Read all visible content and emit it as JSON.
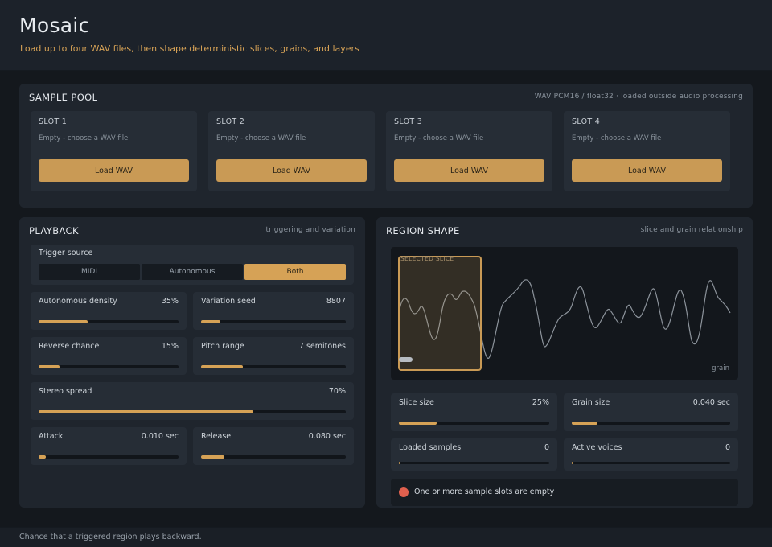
{
  "app": {
    "title": "Mosaic",
    "subtitle": "Load up to four WAV files, then shape deterministic slices, grains, and layers"
  },
  "sample_pool": {
    "title": "SAMPLE POOL",
    "note": "WAV PCM16 / float32 · loaded outside audio processing",
    "slots": [
      {
        "title": "SLOT 1",
        "status": "Empty - choose a WAV file",
        "button": "Load WAV"
      },
      {
        "title": "SLOT 2",
        "status": "Empty - choose a WAV file",
        "button": "Load WAV"
      },
      {
        "title": "SLOT 3",
        "status": "Empty - choose a WAV file",
        "button": "Load WAV"
      },
      {
        "title": "SLOT 4",
        "status": "Empty - choose a WAV file",
        "button": "Load WAV"
      }
    ]
  },
  "playback": {
    "title": "PLAYBACK",
    "note": "triggering and variation",
    "trigger": {
      "label": "Trigger source",
      "options": [
        "MIDI",
        "Autonomous",
        "Both"
      ],
      "selected": "Both"
    },
    "controls": {
      "density": {
        "label": "Autonomous density",
        "value": "35%",
        "fraction": 0.35
      },
      "seed": {
        "label": "Variation seed",
        "value": "8807",
        "fraction": 0.135
      },
      "reverse": {
        "label": "Reverse chance",
        "value": "15%",
        "fraction": 0.15
      },
      "pitch": {
        "label": "Pitch range",
        "value": "7 semitones",
        "fraction": 0.29
      },
      "stereo": {
        "label": "Stereo spread",
        "value": "70%",
        "fraction": 0.7
      },
      "attack": {
        "label": "Attack",
        "value": "0.010 sec",
        "fraction": 0.05
      },
      "release": {
        "label": "Release",
        "value": "0.080 sec",
        "fraction": 0.16
      }
    }
  },
  "region_shape": {
    "title": "REGION SHAPE",
    "note": "slice and grain relationship",
    "waveform": {
      "selected_label": "SELECTED SLICE",
      "grain_label": "grain"
    },
    "controls": {
      "slice": {
        "label": "Slice size",
        "value": "25%",
        "fraction": 0.25
      },
      "grain": {
        "label": "Grain size",
        "value": "0.040 sec",
        "fraction": 0.16
      },
      "loaded": {
        "label": "Loaded samples",
        "value": "0",
        "fraction": 0.0
      },
      "voices": {
        "label": "Active voices",
        "value": "0",
        "fraction": 0.0
      }
    },
    "status": {
      "text": "One or more sample slots are empty",
      "color": "#e0604e"
    }
  },
  "footer": {
    "hint": "Chance that a triggered region plays backward."
  },
  "colors": {
    "accent": "#d6a256",
    "button": "#c99a55",
    "panel": "#1f252d",
    "card": "#262d36"
  }
}
